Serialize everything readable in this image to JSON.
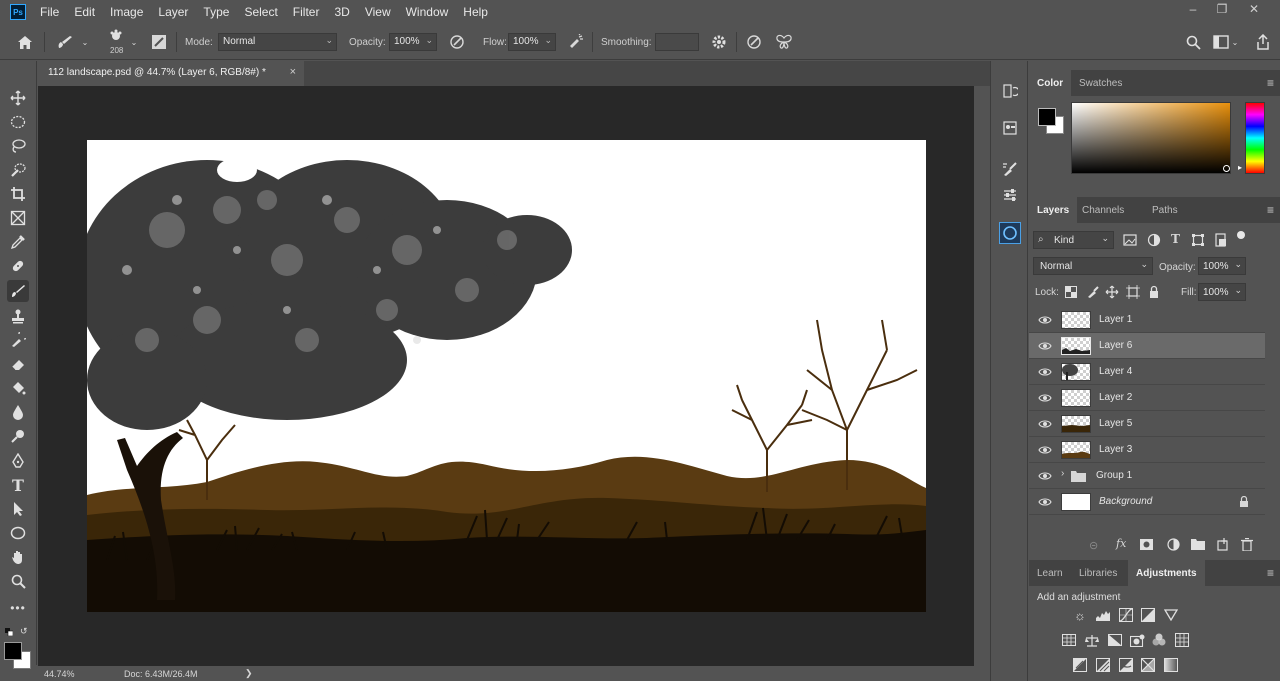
{
  "menu": {
    "logo": "Ps",
    "items": [
      "File",
      "Edit",
      "Image",
      "Layer",
      "Type",
      "Select",
      "Filter",
      "3D",
      "View",
      "Window",
      "Help"
    ]
  },
  "options": {
    "brush_size": "208",
    "mode_label": "Mode:",
    "mode_value": "Normal",
    "opacity_label": "Opacity:",
    "opacity_value": "100%",
    "flow_label": "Flow:",
    "flow_value": "100%",
    "smoothing_label": "Smoothing:",
    "smoothing_value": ""
  },
  "document": {
    "tab_title": "112 landscape.psd @ 44.7% (Layer 6, RGB/8#) *",
    "close_glyph": "×"
  },
  "status": {
    "zoom": "44.74%",
    "doc_size": "Doc: 6.43M/26.4M",
    "arrow": "❯"
  },
  "color_panel": {
    "tabs": [
      "Color",
      "Swatches"
    ],
    "foreground": "#000000",
    "background": "#ffffff",
    "hue": "#e8900c"
  },
  "layers_panel": {
    "tabs": [
      "Layers",
      "Channels",
      "Paths"
    ],
    "filter_kind": "Kind",
    "blend_mode": "Normal",
    "opacity_label": "Opacity:",
    "opacity_value": "100%",
    "lock_label": "Lock:",
    "fill_label": "Fill:",
    "fill_value": "100%",
    "layers": [
      {
        "name": "Layer 1",
        "selected": false
      },
      {
        "name": "Layer 6",
        "selected": true
      },
      {
        "name": "Layer 4",
        "selected": false
      },
      {
        "name": "Layer 2",
        "selected": false
      },
      {
        "name": "Layer 5",
        "selected": false
      },
      {
        "name": "Layer 3",
        "selected": false
      }
    ],
    "group": "Group 1",
    "background_layer": "Background"
  },
  "adjustments_panel": {
    "tabs": [
      "Learn",
      "Libraries",
      "Adjustments"
    ],
    "heading": "Add an adjustment"
  },
  "colors": {
    "ui_bg": "#535353",
    "canvas_area": "#282828",
    "brown_hills": "#5a3b12",
    "brown_mid": "#3a2608",
    "ground": "#130c04"
  }
}
